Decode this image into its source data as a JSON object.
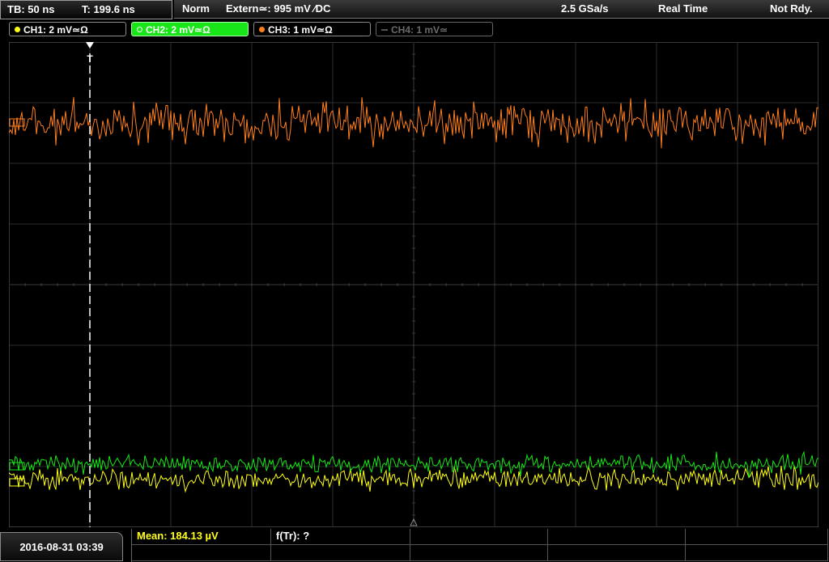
{
  "timebase": {
    "tb": "TB: 50 ns",
    "t": "T: 199.6 ns"
  },
  "status": {
    "mode": "Norm",
    "trigger": "Extern≃: 995 mV ∕DC",
    "sample_rate": "2.5 GSa/s",
    "acq": "Real Time",
    "state": "Not Rdy."
  },
  "channels": [
    {
      "label": "CH1: 2 mV≃Ω",
      "color": "#ffff1a",
      "active": true
    },
    {
      "label": "CH2: 2 mV≃Ω",
      "color": "#19e619",
      "active": true,
      "selected": true
    },
    {
      "label": "CH3: 1 mV≃Ω",
      "color": "#ff7f1f",
      "active": true
    },
    {
      "label": "CH4: 1 mV≃",
      "color": "#777777",
      "active": false
    }
  ],
  "footer": {
    "date": "2016-08-31 03:39",
    "mean": "Mean: 184.13 µV",
    "freq": "f(Tr): ?"
  },
  "colors": {
    "ch1": "#ffff1a",
    "ch2": "#19e619",
    "ch3": "#ff7f1f",
    "grid": "#3a3a3a",
    "trigger_marker": "#ffffff"
  }
}
